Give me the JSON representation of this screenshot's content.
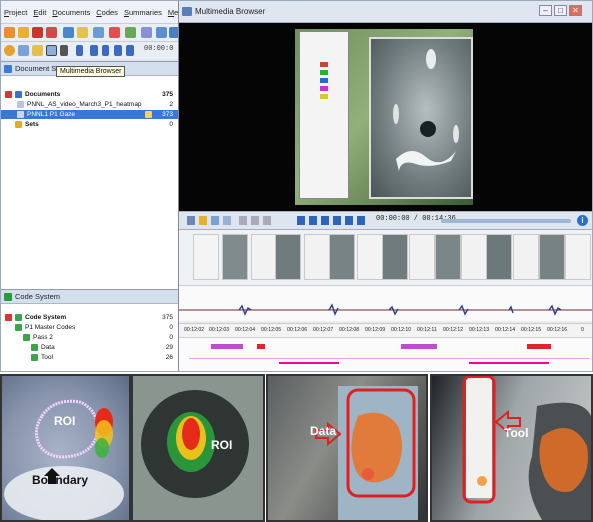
{
  "menu": [
    "Project",
    "Edit",
    "Documents",
    "Codes",
    "Summaries",
    "Memo"
  ],
  "toolbar": {
    "time_small": "00:00:0"
  },
  "document_system": {
    "title": "Document Sy",
    "tooltip": "Multimedia Browser",
    "rows": [
      {
        "label": "Documents",
        "count": "375"
      },
      {
        "label": "PNNL_AS_video_March3_P1_heatmap",
        "count": "2"
      },
      {
        "label": "PNNL1 P1 Gaze",
        "count": "373"
      },
      {
        "label": "Sets",
        "count": "0"
      }
    ]
  },
  "code_system": {
    "title": "Code System",
    "rows": [
      {
        "label": "Code System",
        "count": "375"
      },
      {
        "label": "P1 Master Codes",
        "count": "0"
      },
      {
        "label": "Pass 2",
        "count": "0"
      },
      {
        "label": "Data",
        "count": "29"
      },
      {
        "label": "Tool",
        "count": "26"
      }
    ]
  },
  "multimedia_browser": {
    "title": "Multimedia Browser",
    "window_buttons": [
      "–",
      "□",
      "✕"
    ],
    "timecode": "00:00:00 / 00:14:36",
    "ticks": [
      "00:12:02",
      "00:12:03",
      "00:12:04",
      "00:12:05",
      "00:12:06",
      "00:12:07",
      "00:12:08",
      "00:12:09",
      "00:12:10",
      "00:12:11",
      "00:12:12",
      "00:12:13",
      "00:12:14",
      "00:12:15",
      "00:12:16",
      "0"
    ]
  },
  "photos": {
    "p1_roi": "ROI",
    "p1_boundary": "Boundary",
    "p2_roi": "ROI",
    "p3_data": "Data",
    "p4_tool": "Tool"
  },
  "colors": {
    "accent": "#3a78d8",
    "code_magenta": "#b94fc9",
    "code_red": "#e0242a",
    "annotation_red": "#e02020"
  }
}
